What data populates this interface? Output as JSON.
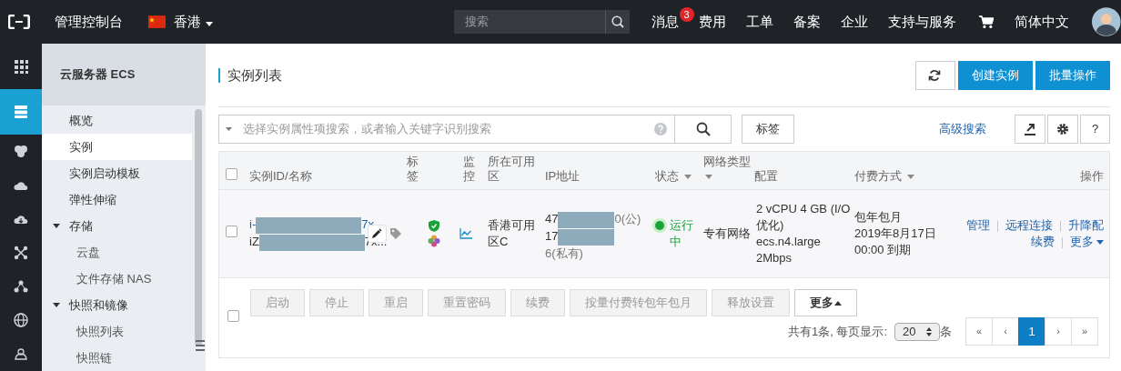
{
  "topbar": {
    "title": "管理控制台",
    "region": "香港",
    "search": {
      "placeholder": "搜索"
    },
    "nav": [
      {
        "label": "消息",
        "badge": "3"
      },
      {
        "label": "费用"
      },
      {
        "label": "工单"
      },
      {
        "label": "备案"
      },
      {
        "label": "企业"
      },
      {
        "label": "支持与服务"
      }
    ],
    "language": "简体中文"
  },
  "rail": [
    {
      "selected": false
    },
    {
      "selected": true
    },
    {
      "selected": false
    },
    {
      "selected": false
    },
    {
      "selected": false
    },
    {
      "selected": false
    },
    {
      "selected": false
    },
    {
      "selected": false
    },
    {
      "selected": false
    }
  ],
  "sidebar": {
    "title": "云服务器 ECS",
    "items": [
      {
        "label": "概览",
        "selected": false
      },
      {
        "label": "实例",
        "selected": true
      },
      {
        "label": "实例启动模板",
        "selected": false
      },
      {
        "label": "弹性伸缩",
        "selected": false
      },
      {
        "label": "存储",
        "selected": false,
        "expanded": true,
        "children": [
          {
            "label": "云盘",
            "selected": false
          },
          {
            "label": "文件存储 NAS",
            "selected": false
          }
        ]
      },
      {
        "label": "快照和镜像",
        "selected": false,
        "expanded": true,
        "children": [
          {
            "label": "快照列表",
            "selected": false
          },
          {
            "label": "快照链",
            "selected": false
          }
        ]
      }
    ]
  },
  "page": {
    "title": "实例列表",
    "buttons": [
      "创建实例",
      "批量操作"
    ]
  },
  "search": {
    "placeholder": "选择实例属性项搜索，或者输入关键字识别搜索",
    "tag_button": "标签",
    "advanced": "高级搜索",
    "help": "?"
  },
  "table": {
    "checked": false,
    "columns": [
      {
        "label": "实例ID/名称",
        "filter": false
      },
      {
        "label": "标签",
        "filter": false
      },
      {
        "label": "监控",
        "filter": false
      },
      {
        "label": "所在可用区",
        "filter": false
      },
      {
        "label": "IP地址",
        "filter": false
      },
      {
        "label": "状态",
        "filter": true
      },
      {
        "label": "网络类型",
        "filter": true
      },
      {
        "label": "配置",
        "filter": false
      },
      {
        "label": "付费方式",
        "filter": true
      },
      {
        "label": "操作",
        "filter": false
      }
    ],
    "rows": [
      {
        "checked": false,
        "id": [
          "i-",
          "7x"
        ],
        "name": [
          "iZ",
          "7x..."
        ],
        "zone": "香港可用区C",
        "ip_public": [
          "47",
          "0(公)"
        ],
        "ip_private": [
          "17",
          "6(私有)"
        ],
        "status": "运行中",
        "network": "专有网络",
        "config": [
          "2 vCPU 4 GB (I/O 优化)",
          "ecs.n4.large",
          "2Mbps"
        ],
        "billing": [
          "包年包月",
          "2019年8月17日 00:00 到期"
        ],
        "actions": [
          [
            "管理",
            "远程连接",
            "升降配"
          ],
          [
            "续费",
            "更多"
          ]
        ]
      }
    ]
  },
  "footer": {
    "checked": false,
    "buttons": [
      {
        "label": "启动",
        "disabled": true
      },
      {
        "label": "停止",
        "disabled": true
      },
      {
        "label": "重启",
        "disabled": true
      },
      {
        "label": "重置密码",
        "disabled": true
      },
      {
        "label": "续费",
        "disabled": true
      },
      {
        "label": "按量付费转包年包月",
        "disabled": true
      },
      {
        "label": "释放设置",
        "disabled": true
      },
      {
        "label": "更多",
        "disabled": false
      }
    ],
    "summary": "共有1条, 每页显示:",
    "page_size": "20",
    "unit": "条",
    "pages": [
      {
        "label": "«",
        "selected": false
      },
      {
        "label": "‹",
        "selected": false
      },
      {
        "label": "1",
        "selected": true
      },
      {
        "label": "›",
        "selected": false
      },
      {
        "label": "»",
        "selected": false
      }
    ]
  }
}
